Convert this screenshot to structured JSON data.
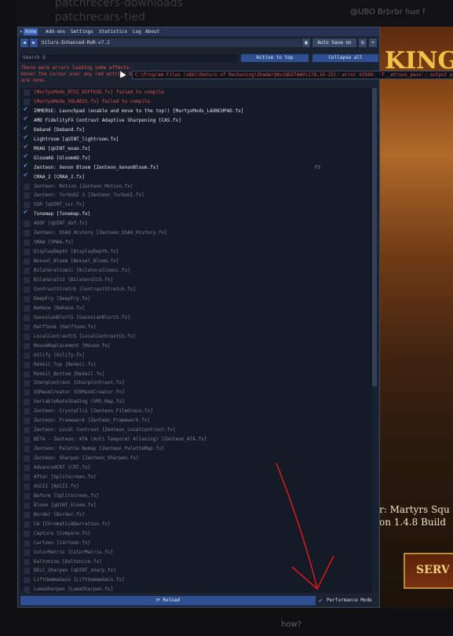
{
  "background": {
    "top_text_1": "patchrecers-downloads",
    "top_text_2": "patchrecars-tied",
    "chat_text": "@UBO Brbrbr hue f",
    "game_title": "KING",
    "game_subtitle_1": "r: Martyrs Squ",
    "game_subtitle_2": "on 1.4.8 Build",
    "game_button": "SERV",
    "bottom_question": "how?"
  },
  "menu": {
    "tabs": [
      "Home",
      "Add-ons",
      "Settings",
      "Statistics",
      "Log",
      "About"
    ],
    "active_index": 0
  },
  "preset": {
    "prev_label": "◀",
    "next_label": "▶",
    "preset_name": "Silurs-Enhanced-RoR-v7.2",
    "save_label": "Auto Save on",
    "remove_label": "⊟",
    "add_label": "+"
  },
  "search": {
    "placeholder": "Search Q",
    "active_to_top_label": "Active to top",
    "collapse_all_label": "Collapse all"
  },
  "errors": {
    "line1": "There were errors loading some effects.",
    "line2": "Hover the cursor over any red entries below to see the related error messages and/or check the log for more details if there",
    "line3": "are none."
  },
  "tooltip_error": "C:\\Program Files (x86)\\Return of Reckoning\\Shader@0x18D37AA0(278,16-25): error X3506: 'F__atrous_pass': output p",
  "effects": [
    {
      "label": "[MartysMods_RTGI_DIFFUSE.fx] failed to compile",
      "checked": false,
      "state": "error"
    },
    {
      "label": "[MartysMods_SOLARIS.fx] failed to compile",
      "checked": false,
      "state": "error"
    },
    {
      "label": "IMMERSE: Launchpad (enable and move to the top!) [MartysMods_LAUNCHPAD.fx]",
      "checked": true,
      "state": "on"
    },
    {
      "label": "AMD FidelityFX Contrast Adaptive Sharpening [CAS.fx]",
      "checked": true,
      "state": "on"
    },
    {
      "label": "Deband [Deband.fx]",
      "checked": true,
      "state": "on"
    },
    {
      "label": "Lightroom [qUINT_lightroom.fx]",
      "checked": true,
      "state": "on"
    },
    {
      "label": "MXAO [qUINT_mxao.fx]",
      "checked": true,
      "state": "on"
    },
    {
      "label": "GloomAO [GloomAO.fx]",
      "checked": true,
      "state": "on"
    },
    {
      "label": "Zenteon: Xenon Bloom [Zenteon_XenonBloom.fx]",
      "checked": true,
      "state": "on",
      "extra": "FS"
    },
    {
      "label": "CMAA_2 [CMAA_2.fx]",
      "checked": true,
      "state": "on"
    },
    {
      "label": "Zenteon: Motion [Zenteon_Motion.fx]",
      "checked": false,
      "state": "off"
    },
    {
      "label": "Zenteon: TurboGI 3 [Zenteon_TurboGI.fx]",
      "checked": false,
      "state": "off"
    },
    {
      "label": "SSR [qUINT_ssr.fx]",
      "checked": false,
      "state": "off"
    },
    {
      "label": "Tonemap [Tonemap.fx]",
      "checked": true,
      "state": "on"
    },
    {
      "label": "ADOF [qUINT_dof.fx]",
      "checked": false,
      "state": "off"
    },
    {
      "label": "Zenteon: SSAO History [Zenteon_SSAO_History.fx]",
      "checked": false,
      "state": "off"
    },
    {
      "label": "SMAA [SMAA.fx]",
      "checked": false,
      "state": "off"
    },
    {
      "label": "DisplayDepth [DisplayDepth.fx]",
      "checked": false,
      "state": "off"
    },
    {
      "label": "Bessel_Bloom [Bessel_Bloom.fx]",
      "checked": false,
      "state": "off"
    },
    {
      "label": "BilateralComic [BilateralComic.fx]",
      "checked": false,
      "state": "off"
    },
    {
      "label": "BilateralCS [BilateralCS.fx]",
      "checked": false,
      "state": "off"
    },
    {
      "label": "ContrastStretch [ContrastStretch.fx]",
      "checked": false,
      "state": "off"
    },
    {
      "label": "DeepFry [DeepFry.fx]",
      "checked": false,
      "state": "off"
    },
    {
      "label": "DeHaze [Dehaze.fx]",
      "checked": false,
      "state": "off"
    },
    {
      "label": "GaussianBlurCS [GaussianBlurCS.fx]",
      "checked": false,
      "state": "off"
    },
    {
      "label": "Halftone [Halftone.fx]",
      "checked": false,
      "state": "off"
    },
    {
      "label": "LocalContrastCS [LocalContrastCS.fx]",
      "checked": false,
      "state": "off"
    },
    {
      "label": "MouseReplacement [Mouse.fx]",
      "checked": false,
      "state": "off"
    },
    {
      "label": "Oilify [Oilify.fx]",
      "checked": false,
      "state": "off"
    },
    {
      "label": "ReVeil_Top [ReVeil.fx]",
      "checked": false,
      "state": "off"
    },
    {
      "label": "ReVeil_Bottom [ReVeil.fx]",
      "checked": false,
      "state": "off"
    },
    {
      "label": "SharpContrast [SharpContrast.fx]",
      "checked": false,
      "state": "off"
    },
    {
      "label": "USMaskCreator [USMaskCreator.fx]",
      "checked": false,
      "state": "off"
    },
    {
      "label": "VariableRateShading [VRS_Map.fx]",
      "checked": false,
      "state": "off"
    },
    {
      "label": "Zenteon: Crystallis [Zenteon_FilmGrain.fx]",
      "checked": false,
      "state": "off"
    },
    {
      "label": "Zenteon: Framework [Zenteon_Framework.fx]",
      "checked": false,
      "state": "off"
    },
    {
      "label": "Zenteon: Local Contrast [Zenteon_LocalContrast.fx]",
      "checked": false,
      "state": "off"
    },
    {
      "label": "BETA - Zenteon: ATA (Anti Temporal Aliasing)  [Zenteon_ATA.fx]",
      "checked": false,
      "state": "off"
    },
    {
      "label": "Zenteon: Palette Remap [Zenteon_PaletteMap.fx]",
      "checked": false,
      "state": "off"
    },
    {
      "label": "Zenteon: Sharpen [Zenteon_Sharpen.fx]",
      "checked": false,
      "state": "off"
    },
    {
      "label": "AdvancedCRT [CRT.fx]",
      "checked": false,
      "state": "off"
    },
    {
      "label": "After [Splitscreen.fx]",
      "checked": false,
      "state": "off"
    },
    {
      "label": "ASCII [ASCII.fx]",
      "checked": false,
      "state": "off"
    },
    {
      "label": "Before [Splitscreen.fx]",
      "checked": false,
      "state": "off"
    },
    {
      "label": "Bloom [qUINT_bloom.fx]",
      "checked": false,
      "state": "off"
    },
    {
      "label": "Border [Border.fx]",
      "checked": false,
      "state": "off"
    },
    {
      "label": "CA [ChromaticAberration.fx]",
      "checked": false,
      "state": "off"
    },
    {
      "label": "Capture [Compare.fx]",
      "checked": false,
      "state": "off"
    },
    {
      "label": "Cartoon [Cartoon.fx]",
      "checked": false,
      "state": "off"
    },
    {
      "label": "ColorMatrix [ColorMatrix.fx]",
      "checked": false,
      "state": "off"
    },
    {
      "label": "Daltonize [Daltonize.fx]",
      "checked": false,
      "state": "off"
    },
    {
      "label": "DELC_Sharpen [qUINT_sharp.fx]",
      "checked": false,
      "state": "off"
    },
    {
      "label": "LiftGammaGain [LiftGammaGain.fx]",
      "checked": false,
      "state": "off"
    },
    {
      "label": "LumaSharpen [LumaSharpen.fx]",
      "checked": false,
      "state": "off"
    }
  ],
  "bottom": {
    "reload_label": "⟳ Reload",
    "performance_mode_label": "Performance Mode",
    "performance_mode_checked": true
  },
  "colors": {
    "accent": "#3b63b7",
    "error": "#e05050",
    "annotation_arrow": "#e01818"
  }
}
